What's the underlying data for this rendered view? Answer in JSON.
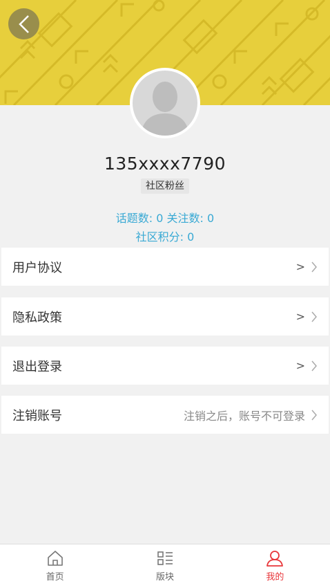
{
  "profile": {
    "username": "135xxxx7790",
    "role": "社区粉丝",
    "stats_line1": "话题数: 0 关注数: 0",
    "stats_line2": "社区积分: 0"
  },
  "menu": [
    {
      "label": "用户协议",
      "hint": ">"
    },
    {
      "label": "隐私政策",
      "hint": ">"
    },
    {
      "label": "退出登录",
      "hint": ">"
    },
    {
      "label": "注销账号",
      "hint": "注销之后，账号不可登录"
    }
  ],
  "tabs": [
    {
      "label": "首页",
      "icon": "home-icon"
    },
    {
      "label": "版块",
      "icon": "category-icon"
    },
    {
      "label": "我的",
      "icon": "user-icon"
    }
  ],
  "colors": {
    "banner": "#e7cf3c",
    "accent_blue": "#39a9d4",
    "active_red": "#e8363a"
  }
}
